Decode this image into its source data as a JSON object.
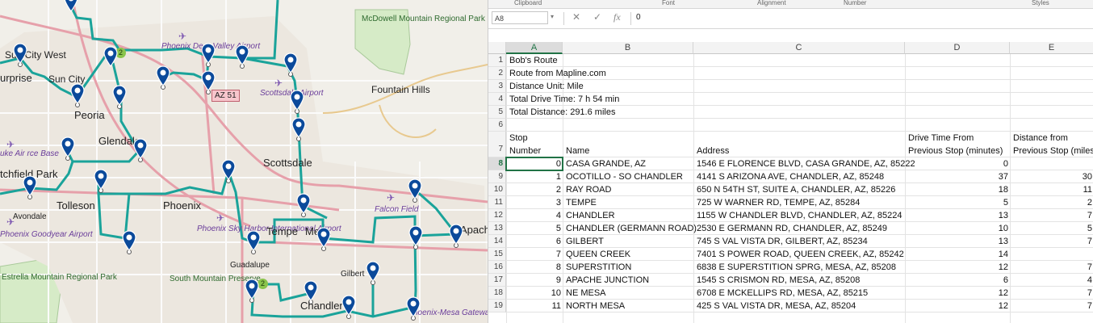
{
  "map": {
    "labels": {
      "sun_city_west": "Sun City West",
      "surprise": "urprise",
      "sun_city": "Sun City",
      "peoria": "Peoria",
      "glendale": "Glendale",
      "phoenix": "Phoenix",
      "scottsdale": "Scottsdale",
      "fountain_hills": "Fountain Hills",
      "tolleson": "Tolleson",
      "avondale": "Avondale",
      "litchfield_park": "tchfield Park",
      "tempe": "Tempe",
      "mesa": "Mesa",
      "gilbert": "Gilbert",
      "guadalupe": "Guadalupe",
      "chandler": "Chandler",
      "apache": "Apache"
    },
    "parks": {
      "mcdowell": "McDowell Mountain Regional Park",
      "south_mountain": "South Mountain Preserve",
      "estrella": "Estrella Mountain Regional Park"
    },
    "airports": {
      "deer_valley": "Phoenix Deer Valley Airport",
      "scottsdale_airport": "Scottsdale Airport",
      "sky_harbor": "Phoenix Sky Harbor International Airport",
      "falcon_field": "Falcon Field",
      "goodyear": "Phoenix Goodyear Airport",
      "luke_air": "uke Air rce Base",
      "mesa_gateway": "hoenix-Mesa Gateway"
    },
    "shield_az51": "AZ 51",
    "badge_a": "2",
    "badge_b": "2",
    "route_color": "#1aa39a",
    "pin_color": "#0b4a9b"
  },
  "excel": {
    "ribbon_groups": [
      "Clipboard",
      "Font",
      "Alignment",
      "Number",
      "Styles"
    ],
    "name_box": "A8",
    "formula_value": "0",
    "icons": {
      "cancel": "cancel-icon",
      "enter": "check-icon",
      "function": "fx-icon"
    },
    "columns": [
      "A",
      "B",
      "C",
      "D",
      "E"
    ],
    "rows": [
      {
        "n": "1",
        "a": "Bob's Route"
      },
      {
        "n": "2",
        "a": "Route from Mapline.com"
      },
      {
        "n": "3",
        "a": "Distance Unit: Mile"
      },
      {
        "n": "4",
        "a": "Total Drive Time: 7 h 54 min"
      },
      {
        "n": "5",
        "a": "Total Distance: 291.6 miles"
      },
      {
        "n": "6"
      },
      {
        "n": "7"
      }
    ],
    "headers": {
      "stop": "Stop",
      "number": "Number",
      "name": "Name",
      "address": "Address",
      "drive_time_1": "Drive Time From",
      "drive_time_2": "Previous Stop (minutes)",
      "distance_1": "Distance from",
      "distance_2": "Previous Stop (miles"
    },
    "data": [
      {
        "row": "8",
        "stop": "0",
        "name": "CASA GRANDE, AZ",
        "address": "1546 E FLORENCE BLVD, CASA GRANDE, AZ, 85222",
        "time": "0",
        "dist": ""
      },
      {
        "row": "9",
        "stop": "1",
        "name": "OCOTILLO - SO CHANDLER",
        "address": "4141 S ARIZONA AVE, CHANDLER, AZ, 85248",
        "time": "37",
        "dist": "30"
      },
      {
        "row": "10",
        "stop": "2",
        "name": "RAY ROAD",
        "address": "650 N 54TH ST, SUITE A, CHANDLER, AZ, 85226",
        "time": "18",
        "dist": "11"
      },
      {
        "row": "11",
        "stop": "3",
        "name": "TEMPE",
        "address": "725 W WARNER RD, TEMPE, AZ, 85284",
        "time": "5",
        "dist": "2"
      },
      {
        "row": "12",
        "stop": "4",
        "name": "CHANDLER",
        "address": "1155 W CHANDLER BLVD, CHANDLER, AZ, 85224",
        "time": "13",
        "dist": "7"
      },
      {
        "row": "13",
        "stop": "5",
        "name": "CHANDLER (GERMANN ROAD)",
        "address": "2530 E GERMANN RD, CHANDLER, AZ, 85249",
        "time": "10",
        "dist": "5"
      },
      {
        "row": "14",
        "stop": "6",
        "name": "GILBERT",
        "address": "745 S VAL VISTA DR, GILBERT, AZ, 85234",
        "time": "13",
        "dist": "7"
      },
      {
        "row": "15",
        "stop": "7",
        "name": "QUEEN CREEK",
        "address": "7401 S POWER ROAD, QUEEN CREEK, AZ, 85242",
        "time": "14",
        "dist": ""
      },
      {
        "row": "16",
        "stop": "8",
        "name": "SUPERSTITION",
        "address": "6838 E SUPERSTITION SPRG, MESA, AZ, 85208",
        "time": "12",
        "dist": "7"
      },
      {
        "row": "17",
        "stop": "9",
        "name": "APACHE JUNCTION",
        "address": "1545 S CRISMON RD, MESA, AZ, 85208",
        "time": "6",
        "dist": "4"
      },
      {
        "row": "18",
        "stop": "10",
        "name": "NE MESA",
        "address": "6708 E MCKELLIPS RD, MESA, AZ, 85215",
        "time": "12",
        "dist": "7"
      },
      {
        "row": "19",
        "stop": "11",
        "name": "NORTH MESA",
        "address": "425 S VAL VISTA DR, MESA, AZ, 85204",
        "time": "12",
        "dist": "7"
      }
    ]
  }
}
